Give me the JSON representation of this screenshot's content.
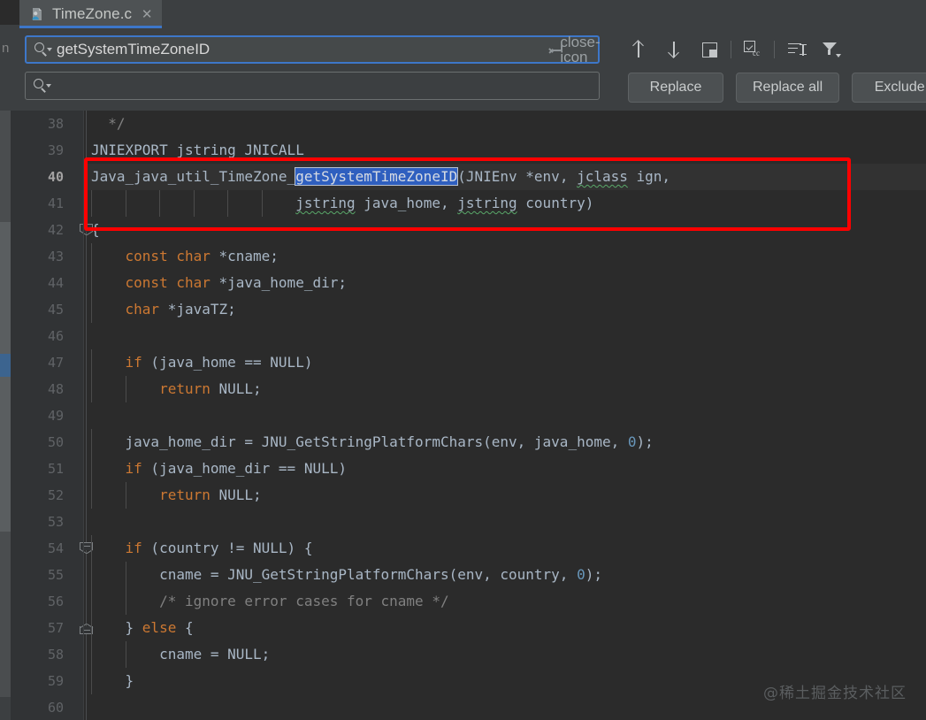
{
  "window": {
    "left_strip_glyph": "n"
  },
  "tab": {
    "label": "TimeZone.c",
    "close": "✕",
    "icon": "c-file-user-icon"
  },
  "find": {
    "search_value": "getSystemTimeZoneID",
    "search_placeholder": "",
    "replace_value": "",
    "replace_placeholder": "",
    "search_icon": "magnifier-icon",
    "return_icon": "return-to-match-icon",
    "clear_icon": "close-icon",
    "tools": [
      {
        "name": "find-previous-icon",
        "title": "Previous Occurrence"
      },
      {
        "name": "find-next-icon",
        "title": "Next Occurrence"
      },
      {
        "name": "select-all-occurrences-icon",
        "title": "Select All Occurrences"
      },
      {
        "name": "match-case-icon",
        "title": "Match Case"
      },
      {
        "name": "words-icon",
        "title": "Words"
      },
      {
        "name": "filter-icon",
        "title": "Filter Search Results"
      }
    ],
    "buttons": [
      {
        "name": "replace-button",
        "label": "Replace",
        "mnemonic": "l"
      },
      {
        "name": "replace-all-button",
        "label": "Replace all",
        "mnemonic": "a"
      },
      {
        "name": "exclude-button",
        "label": "Exclude",
        "mnemonic": "l"
      }
    ]
  },
  "editor": {
    "first_line": 38,
    "current_line": 40,
    "line_numbers": [
      38,
      39,
      40,
      41,
      42,
      43,
      44,
      45,
      46,
      47,
      48,
      49,
      50,
      51,
      52,
      53,
      54,
      55,
      56,
      57,
      58,
      59,
      60
    ],
    "lines": [
      {
        "n": 38,
        "segments": [
          {
            "t": "  */",
            "c": "cmt"
          }
        ]
      },
      {
        "n": 39,
        "segments": [
          {
            "t": "JNIEXPORT jstring JNICALL",
            "c": "txt"
          }
        ]
      },
      {
        "n": 40,
        "current": true,
        "segments": [
          {
            "t": "Java_java_util_TimeZone_",
            "c": "txt"
          },
          {
            "t": "getSystemTimeZoneID",
            "c": "sel"
          },
          {
            "t": "(JNIEnv *env, ",
            "c": "txt"
          },
          {
            "t": "jclass",
            "c": "wavy"
          },
          {
            "t": " ign,",
            "c": "txt"
          }
        ]
      },
      {
        "n": 41,
        "segments": [
          {
            "t": "                        ",
            "c": "txt"
          },
          {
            "t": "jstring",
            "c": "wavy"
          },
          {
            "t": " java_home, ",
            "c": "txt"
          },
          {
            "t": "jstring",
            "c": "wavy"
          },
          {
            "t": " country)",
            "c": "txt"
          }
        ]
      },
      {
        "n": 42,
        "segments": [
          {
            "t": "{",
            "c": "txt"
          }
        ]
      },
      {
        "n": 43,
        "segments": [
          {
            "t": "    ",
            "c": "txt"
          },
          {
            "t": "const char",
            "c": "kw"
          },
          {
            "t": " *cname;",
            "c": "txt"
          }
        ]
      },
      {
        "n": 44,
        "segments": [
          {
            "t": "    ",
            "c": "txt"
          },
          {
            "t": "const char",
            "c": "kw"
          },
          {
            "t": " *java_home_dir;",
            "c": "txt"
          }
        ]
      },
      {
        "n": 45,
        "segments": [
          {
            "t": "    ",
            "c": "txt"
          },
          {
            "t": "char",
            "c": "kw"
          },
          {
            "t": " *javaTZ;",
            "c": "txt"
          }
        ]
      },
      {
        "n": 46,
        "segments": []
      },
      {
        "n": 47,
        "segments": [
          {
            "t": "    ",
            "c": "txt"
          },
          {
            "t": "if",
            "c": "kw"
          },
          {
            "t": " (java_home == NULL)",
            "c": "txt"
          }
        ]
      },
      {
        "n": 48,
        "segments": [
          {
            "t": "        ",
            "c": "txt"
          },
          {
            "t": "return",
            "c": "kw"
          },
          {
            "t": " NULL;",
            "c": "txt"
          }
        ]
      },
      {
        "n": 49,
        "segments": []
      },
      {
        "n": 50,
        "segments": [
          {
            "t": "    java_home_dir = JNU_GetStringPlatformChars(env, java_home, ",
            "c": "txt"
          },
          {
            "t": "0",
            "c": "num"
          },
          {
            "t": ");",
            "c": "txt"
          }
        ]
      },
      {
        "n": 51,
        "segments": [
          {
            "t": "    ",
            "c": "txt"
          },
          {
            "t": "if",
            "c": "kw"
          },
          {
            "t": " (java_home_dir == NULL)",
            "c": "txt"
          }
        ]
      },
      {
        "n": 52,
        "segments": [
          {
            "t": "        ",
            "c": "txt"
          },
          {
            "t": "return",
            "c": "kw"
          },
          {
            "t": " NULL;",
            "c": "txt"
          }
        ]
      },
      {
        "n": 53,
        "segments": []
      },
      {
        "n": 54,
        "segments": [
          {
            "t": "    ",
            "c": "txt"
          },
          {
            "t": "if",
            "c": "kw"
          },
          {
            "t": " (country != NULL) {",
            "c": "txt"
          }
        ]
      },
      {
        "n": 55,
        "segments": [
          {
            "t": "        cname = JNU_GetStringPlatformChars(env, country, ",
            "c": "txt"
          },
          {
            "t": "0",
            "c": "num"
          },
          {
            "t": ");",
            "c": "txt"
          }
        ]
      },
      {
        "n": 56,
        "segments": [
          {
            "t": "        ",
            "c": "txt"
          },
          {
            "t": "/* ignore error cases for cname */",
            "c": "cmt"
          }
        ]
      },
      {
        "n": 57,
        "segments": [
          {
            "t": "    } ",
            "c": "txt"
          },
          {
            "t": "else",
            "c": "kw"
          },
          {
            "t": " {",
            "c": "txt"
          }
        ]
      },
      {
        "n": 58,
        "segments": [
          {
            "t": "        cname = NULL;",
            "c": "txt"
          }
        ]
      },
      {
        "n": 59,
        "segments": [
          {
            "t": "    }",
            "c": "txt"
          }
        ]
      },
      {
        "n": 60,
        "segments": []
      }
    ],
    "fold_markers": [
      {
        "line": 42,
        "type": "open"
      },
      {
        "line": 54,
        "type": "open"
      },
      {
        "line": 57,
        "type": "close"
      }
    ]
  },
  "annotation": {
    "type": "red-rectangle-highlight",
    "color": "#ff0000",
    "covers_lines": "40-41"
  },
  "watermark": "@稀土掘金技术社区",
  "colors": {
    "editor_background": "#2b2b2b",
    "gutter_background": "#313335",
    "panel_background": "#3c3f41",
    "accent_blue": "#3d77c9",
    "selection_blue": "#2f5fbf",
    "keyword_orange": "#cc7832",
    "number_blue": "#6897bb",
    "comment_grey": "#808080",
    "default_text": "#a9b7c6",
    "annotation_red": "#ff0000"
  }
}
